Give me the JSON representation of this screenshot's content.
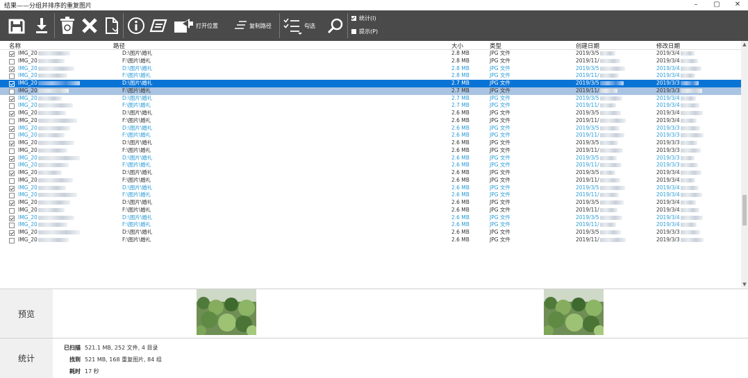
{
  "window": {
    "title": "结果——分组并排序的重复图片",
    "minimize": "–",
    "maximize": "▢",
    "close": "✕"
  },
  "toolbar": {
    "open_location": "打开位置",
    "copy_path": "复制路径",
    "select": "勾选",
    "opt_stats": "统计(I)",
    "opt_stats_checked": true,
    "opt_hint": "提示(P)",
    "opt_hint_checked": false
  },
  "columns": {
    "name": "名称",
    "path": "路径",
    "size": "大小",
    "type": "类型",
    "created": "创建日期",
    "modified": "修改日期"
  },
  "rows": [
    {
      "name": "IMG_20",
      "path": "D:\\图片\\婚礼",
      "size": "2.8 MB",
      "type": "JPG 文件",
      "created": "2019/3/5",
      "modified": "2019/3/4",
      "checked": true,
      "style": "black"
    },
    {
      "name": "IMG_20",
      "path": "F:\\图片\\婚礼",
      "size": "2.8 MB",
      "type": "JPG 文件",
      "created": "2019/11/",
      "modified": "2019/3/4",
      "checked": false,
      "style": "black"
    },
    {
      "name": "IMG_20",
      "path": "D:\\图片\\婚礼",
      "size": "2.8 MB",
      "type": "JPG 文件",
      "created": "2019/3/5",
      "modified": "2019/3/4",
      "checked": true,
      "style": "blue"
    },
    {
      "name": "IMG_20",
      "path": "F:\\图片\\婚礼",
      "size": "2.8 MB",
      "type": "JPG 文件",
      "created": "2019/11/",
      "modified": "2019/3/4",
      "checked": false,
      "style": "blue"
    },
    {
      "name": "IMG_20",
      "path": "D:\\图片\\婚礼",
      "size": "2.7 MB",
      "type": "JPG 文件",
      "created": "2019/3/5",
      "modified": "2019/3/3",
      "checked": true,
      "style": "sel"
    },
    {
      "name": "IMG_20",
      "path": "F:\\图片\\婚礼",
      "size": "2.7 MB",
      "type": "JPG 文件",
      "created": "2019/11/",
      "modified": "2019/3/3",
      "checked": false,
      "style": "sel2"
    },
    {
      "name": "IMG_20",
      "path": "D:\\图片\\婚礼",
      "size": "2.7 MB",
      "type": "JPG 文件",
      "created": "2019/3/5",
      "modified": "2019/3/4",
      "checked": true,
      "style": "blue"
    },
    {
      "name": "IMG_20",
      "path": "F:\\图片\\婚礼",
      "size": "2.7 MB",
      "type": "JPG 文件",
      "created": "2019/11/",
      "modified": "2019/3/4",
      "checked": false,
      "style": "blue"
    },
    {
      "name": "IMG_20",
      "path": "D:\\图片\\婚礼",
      "size": "2.6 MB",
      "type": "JPG 文件",
      "created": "2019/3/5",
      "modified": "2019/3/4",
      "checked": true,
      "style": "black"
    },
    {
      "name": "IMG_20",
      "path": "F:\\图片\\婚礼",
      "size": "2.6 MB",
      "type": "JPG 文件",
      "created": "2019/11/",
      "modified": "2019/3/4",
      "checked": false,
      "style": "black"
    },
    {
      "name": "IMG_20",
      "path": "D:\\图片\\婚礼",
      "size": "2.6 MB",
      "type": "JPG 文件",
      "created": "2019/3/5",
      "modified": "2019/3/3",
      "checked": true,
      "style": "blue"
    },
    {
      "name": "IMG_20",
      "path": "F:\\图片\\婚礼",
      "size": "2.6 MB",
      "type": "JPG 文件",
      "created": "2019/11/",
      "modified": "2019/3/3",
      "checked": false,
      "style": "blue"
    },
    {
      "name": "IMG_20",
      "path": "D:\\图片\\婚礼",
      "size": "2.6 MB",
      "type": "JPG 文件",
      "created": "2019/3/5",
      "modified": "2019/3/3",
      "checked": true,
      "style": "black"
    },
    {
      "name": "IMG_20",
      "path": "F:\\图片\\婚礼",
      "size": "2.6 MB",
      "type": "JPG 文件",
      "created": "2019/11/",
      "modified": "2019/3/3",
      "checked": false,
      "style": "black"
    },
    {
      "name": "IMG_20",
      "path": "D:\\图片\\婚礼",
      "size": "2.6 MB",
      "type": "JPG 文件",
      "created": "2019/3/5",
      "modified": "2019/3/3",
      "checked": true,
      "style": "blue"
    },
    {
      "name": "IMG_20",
      "path": "F:\\图片\\婚礼",
      "size": "2.6 MB",
      "type": "JPG 文件",
      "created": "2019/11/",
      "modified": "2019/3/3",
      "checked": false,
      "style": "blue"
    },
    {
      "name": "IMG_20",
      "path": "D:\\图片\\婚礼",
      "size": "2.6 MB",
      "type": "JPG 文件",
      "created": "2019/3/5",
      "modified": "2019/3/4",
      "checked": true,
      "style": "black"
    },
    {
      "name": "IMG_20",
      "path": "F:\\图片\\婚礼",
      "size": "2.6 MB",
      "type": "JPG 文件",
      "created": "2019/11/",
      "modified": "2019/3/4",
      "checked": false,
      "style": "black"
    },
    {
      "name": "IMG_20",
      "path": "D:\\图片\\婚礼",
      "size": "2.6 MB",
      "type": "JPG 文件",
      "created": "2019/3/5",
      "modified": "2019/3/4",
      "checked": true,
      "style": "blue"
    },
    {
      "name": "IMG_20",
      "path": "F:\\图片\\婚礼",
      "size": "2.6 MB",
      "type": "JPG 文件",
      "created": "2019/11/",
      "modified": "2019/3/4",
      "checked": false,
      "style": "blue"
    },
    {
      "name": "IMG_20",
      "path": "D:\\图片\\婚礼",
      "size": "2.6 MB",
      "type": "JPG 文件",
      "created": "2019/3/5",
      "modified": "2019/3/4",
      "checked": true,
      "style": "black"
    },
    {
      "name": "IMG_20",
      "path": "F:\\图片\\婚礼",
      "size": "2.6 MB",
      "type": "JPG 文件",
      "created": "2019/11/",
      "modified": "2019/3/4",
      "checked": false,
      "style": "black"
    },
    {
      "name": "IMG_20",
      "path": "D:\\图片\\婚礼",
      "size": "2.6 MB",
      "type": "JPG 文件",
      "created": "2019/3/5",
      "modified": "2019/3/4",
      "checked": true,
      "style": "blue"
    },
    {
      "name": "IMG_20",
      "path": "F:\\图片\\婚礼",
      "size": "2.6 MB",
      "type": "JPG 文件",
      "created": "2019/11/",
      "modified": "2019/3/4",
      "checked": false,
      "style": "blue"
    },
    {
      "name": "IMG_20",
      "path": "D:\\图片\\婚礼",
      "size": "2.6 MB",
      "type": "JPG 文件",
      "created": "2019/3/5",
      "modified": "2019/3/3",
      "checked": true,
      "style": "black"
    },
    {
      "name": "IMG_20",
      "path": "F:\\图片\\婚礼",
      "size": "2.6 MB",
      "type": "JPG 文件",
      "created": "2019/11/",
      "modified": "2019/3/3",
      "checked": false,
      "style": "black"
    }
  ],
  "preview": {
    "label": "预览"
  },
  "stats": {
    "label": "统计",
    "scanned_key": "已扫描",
    "scanned_val": "521.1 MB, 252 文件, 4 目录",
    "found_key": "找到",
    "found_val": "521 MB, 168 重复图片, 84 组",
    "elapsed_key": "耗时",
    "elapsed_val": "17 秒"
  }
}
